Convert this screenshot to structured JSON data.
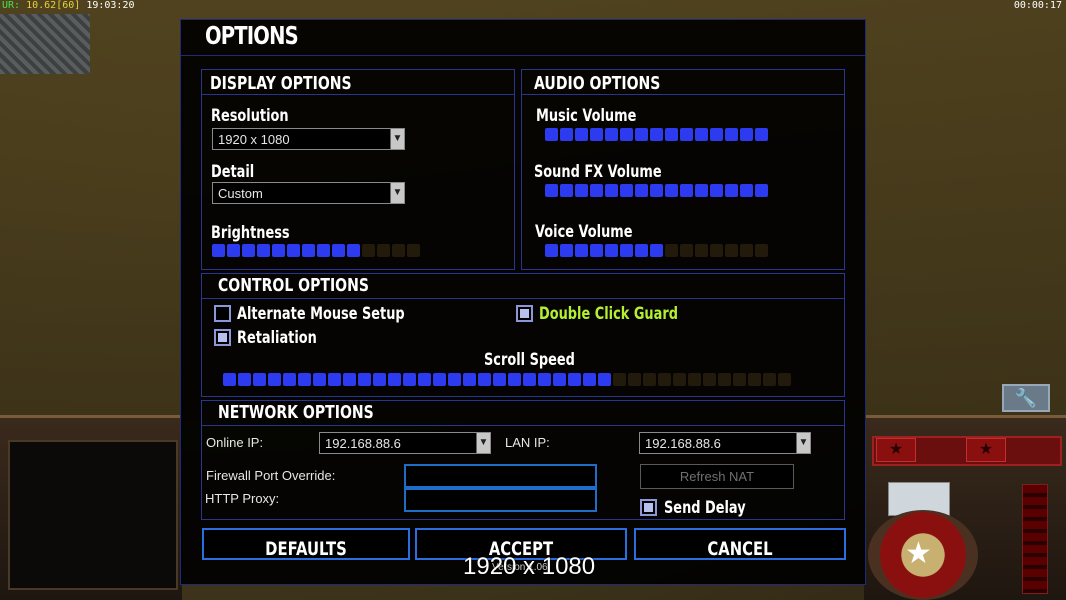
{
  "overlay": {
    "fps_label": "UR:",
    "fps_value": "10.62",
    "fps_target": "[60]",
    "clock": "19:03:20",
    "game_timer": "00:00:17",
    "resolution": "1920 x 1080",
    "version": "Version 1.06"
  },
  "dialog": {
    "title": "OPTIONS",
    "display": {
      "title": "DISPLAY OPTIONS",
      "resolution_label": "Resolution",
      "resolution_value": "1920 x 1080",
      "detail_label": "Detail",
      "detail_value": "Custom",
      "brightness_label": "Brightness",
      "brightness_level": 10,
      "brightness_max": 14
    },
    "audio": {
      "title": "AUDIO OPTIONS",
      "music_label": "Music Volume",
      "music_level": 15,
      "music_max": 15,
      "sfx_label": "Sound FX Volume",
      "sfx_level": 15,
      "sfx_max": 15,
      "voice_label": "Voice Volume",
      "voice_level": 8,
      "voice_max": 15
    },
    "control": {
      "title": "CONTROL OPTIONS",
      "alt_mouse_label": "Alternate Mouse Setup",
      "alt_mouse_checked": false,
      "retaliation_label": "Retaliation",
      "retaliation_checked": true,
      "double_click_label": "Double Click Guard",
      "double_click_checked": true,
      "scroll_label": "Scroll Speed",
      "scroll_level": 26,
      "scroll_max": 38
    },
    "network": {
      "title": "NETWORK OPTIONS",
      "online_ip_label": "Online IP:",
      "online_ip_value": "192.168.88.6",
      "lan_ip_label": "LAN IP:",
      "lan_ip_value": "192.168.88.6",
      "firewall_label": "Firewall Port Override:",
      "firewall_value": "",
      "proxy_label": "HTTP Proxy:",
      "proxy_value": "",
      "refresh_nat_label": "Refresh NAT",
      "send_delay_label": "Send Delay",
      "send_delay_checked": true
    },
    "buttons": {
      "defaults": "DEFAULTS",
      "accept": "ACCEPT",
      "cancel": "CANCEL"
    }
  },
  "colors": {
    "accent_blue": "#2c3af0",
    "border_blue": "#2a6ee0",
    "highlight_green": "#b4f032"
  }
}
